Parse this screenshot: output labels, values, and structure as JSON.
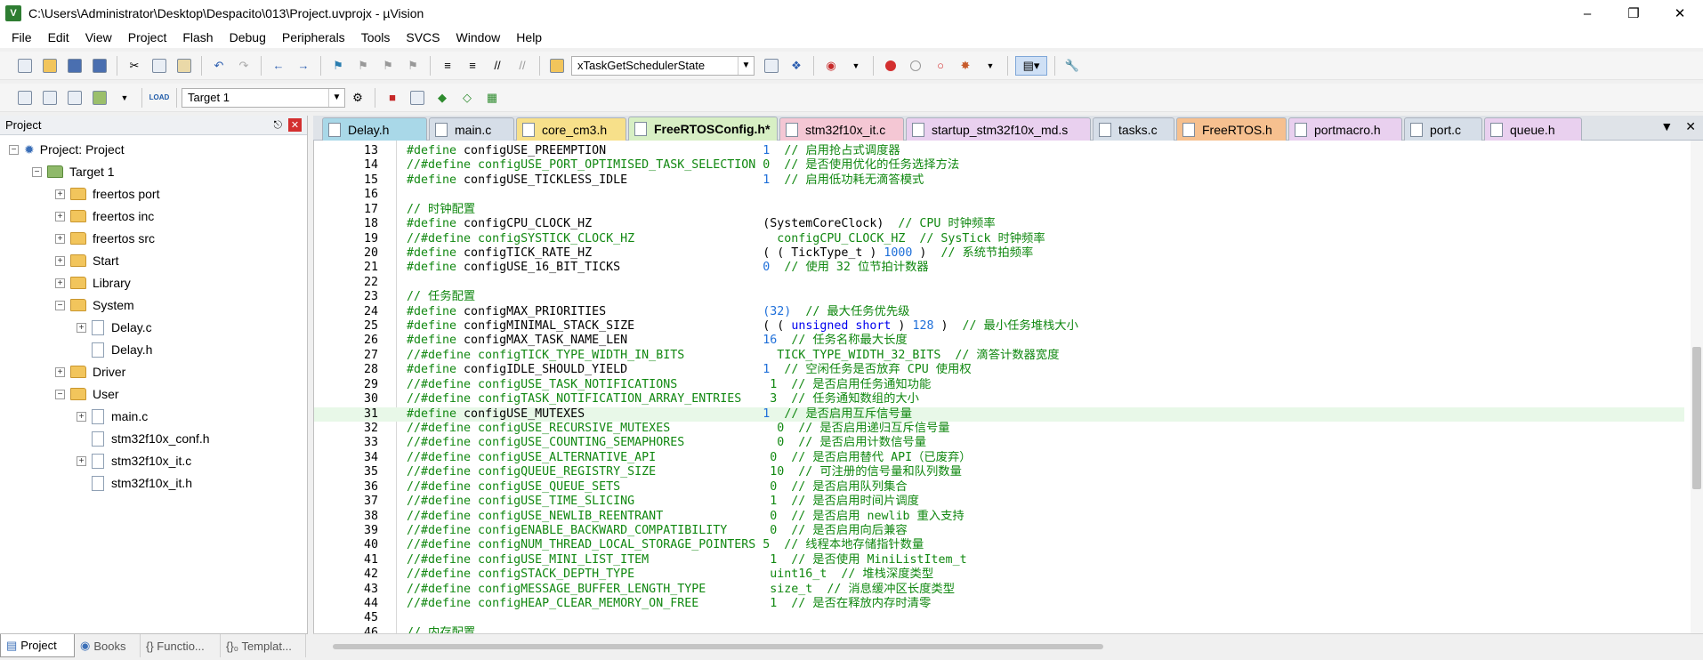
{
  "window": {
    "title": "C:\\Users\\Administrator\\Desktop\\Despacito\\013\\Project.uvprojx - µVision"
  },
  "menu": [
    "File",
    "Edit",
    "View",
    "Project",
    "Flash",
    "Debug",
    "Peripherals",
    "Tools",
    "SVCS",
    "Window",
    "Help"
  ],
  "toolbar": {
    "function_combo": "xTaskGetSchedulerState",
    "target_combo": "Target 1"
  },
  "project_panel": {
    "title": "Project",
    "tree": [
      {
        "label": "Project: Project",
        "kind": "root"
      },
      {
        "label": "Target 1",
        "kind": "target"
      },
      {
        "label": "freertos port",
        "kind": "folder"
      },
      {
        "label": "freertos inc",
        "kind": "folder"
      },
      {
        "label": "freertos src",
        "kind": "folder"
      },
      {
        "label": "Start",
        "kind": "folder"
      },
      {
        "label": "Library",
        "kind": "folder"
      },
      {
        "label": "System",
        "kind": "folder-open"
      },
      {
        "label": "Delay.c",
        "kind": "file"
      },
      {
        "label": "Delay.h",
        "kind": "file"
      },
      {
        "label": "Driver",
        "kind": "folder"
      },
      {
        "label": "User",
        "kind": "folder-open"
      },
      {
        "label": "main.c",
        "kind": "file"
      },
      {
        "label": "stm32f10x_conf.h",
        "kind": "file"
      },
      {
        "label": "stm32f10x_it.c",
        "kind": "file"
      },
      {
        "label": "stm32f10x_it.h",
        "kind": "file"
      }
    ],
    "bottom_tabs": [
      "Project",
      "Books",
      "{} Functio...",
      "{}₀ Templat..."
    ]
  },
  "editor_tabs": [
    {
      "label": "Delay.h",
      "color": "#a9d8e8"
    },
    {
      "label": "main.c",
      "color": "#d6dee8"
    },
    {
      "label": "core_cm3.h",
      "color": "#f7e08a"
    },
    {
      "label": "FreeRTOSConfig.h*",
      "color": "#d7efc4"
    },
    {
      "label": "stm32f10x_it.c",
      "color": "#f4c7d4"
    },
    {
      "label": "startup_stm32f10x_md.s",
      "color": "#e9d0ef"
    },
    {
      "label": "tasks.c",
      "color": "#d6dee8"
    },
    {
      "label": "FreeRTOS.h",
      "color": "#f6c08f"
    },
    {
      "label": "portmacro.h",
      "color": "#e9d0ef"
    },
    {
      "label": "port.c",
      "color": "#d6dee8"
    },
    {
      "label": "queue.h",
      "color": "#e9d0ef"
    }
  ],
  "code": [
    {
      "n": "13",
      "t": "#define configUSE_PREEMPTION                      1  // 启用抢占式调度器"
    },
    {
      "n": "14",
      "t": "//#define configUSE_PORT_OPTIMISED_TASK_SELECTION 0  // 是否使用优化的任务选择方法"
    },
    {
      "n": "15",
      "t": "#define configUSE_TICKLESS_IDLE                   1  // 启用低功耗无滴答模式"
    },
    {
      "n": "16",
      "t": ""
    },
    {
      "n": "17",
      "t": "// 时钟配置"
    },
    {
      "n": "18",
      "t": "#define configCPU_CLOCK_HZ                        (SystemCoreClock)  // CPU 时钟频率"
    },
    {
      "n": "19",
      "t": "//#define configSYSTICK_CLOCK_HZ                    configCPU_CLOCK_HZ  // SysTick 时钟频率"
    },
    {
      "n": "20",
      "t": "#define configTICK_RATE_HZ                        ( ( TickType_t ) 1000 )  // 系统节拍频率"
    },
    {
      "n": "21",
      "t": "#define configUSE_16_BIT_TICKS                    0  // 使用 32 位节拍计数器"
    },
    {
      "n": "22",
      "t": ""
    },
    {
      "n": "23",
      "t": "// 任务配置"
    },
    {
      "n": "24",
      "t": "#define configMAX_PRIORITIES                      (32)  // 最大任务优先级"
    },
    {
      "n": "25",
      "t": "#define configMINIMAL_STACK_SIZE                  ( ( unsigned short ) 128 )  // 最小任务堆栈大小"
    },
    {
      "n": "26",
      "t": "#define configMAX_TASK_NAME_LEN                   16  // 任务名称最大长度"
    },
    {
      "n": "27",
      "t": "//#define configTICK_TYPE_WIDTH_IN_BITS             TICK_TYPE_WIDTH_32_BITS  // 滴答计数器宽度"
    },
    {
      "n": "28",
      "t": "#define configIDLE_SHOULD_YIELD                   1  // 空闲任务是否放弃 CPU 使用权"
    },
    {
      "n": "29",
      "t": "//#define configUSE_TASK_NOTIFICATIONS             1  // 是否启用任务通知功能"
    },
    {
      "n": "30",
      "t": "//#define configTASK_NOTIFICATION_ARRAY_ENTRIES    3  // 任务通知数组的大小"
    },
    {
      "n": "31",
      "t": "#define configUSE_MUTEXES                         1  // 是否启用互斥信号量"
    },
    {
      "n": "32",
      "t": "//#define configUSE_RECURSIVE_MUTEXES               0  // 是否启用递归互斥信号量"
    },
    {
      "n": "33",
      "t": "//#define configUSE_COUNTING_SEMAPHORES             0  // 是否启用计数信号量"
    },
    {
      "n": "34",
      "t": "//#define configUSE_ALTERNATIVE_API                0  // 是否启用替代 API（已废弃）"
    },
    {
      "n": "35",
      "t": "//#define configQUEUE_REGISTRY_SIZE                10  // 可注册的信号量和队列数量"
    },
    {
      "n": "36",
      "t": "//#define configUSE_QUEUE_SETS                     0  // 是否启用队列集合"
    },
    {
      "n": "37",
      "t": "//#define configUSE_TIME_SLICING                   1  // 是否启用时间片调度"
    },
    {
      "n": "38",
      "t": "//#define configUSE_NEWLIB_REENTRANT               0  // 是否启用 newlib 重入支持"
    },
    {
      "n": "39",
      "t": "//#define configENABLE_BACKWARD_COMPATIBILITY      0  // 是否启用向后兼容"
    },
    {
      "n": "40",
      "t": "//#define configNUM_THREAD_LOCAL_STORAGE_POINTERS 5  // 线程本地存储指针数量"
    },
    {
      "n": "41",
      "t": "//#define configUSE_MINI_LIST_ITEM                 1  // 是否使用 MiniListItem_t"
    },
    {
      "n": "42",
      "t": "//#define configSTACK_DEPTH_TYPE                   uint16_t  // 堆栈深度类型"
    },
    {
      "n": "43",
      "t": "//#define configMESSAGE_BUFFER_LENGTH_TYPE         size_t  // 消息缓冲区长度类型"
    },
    {
      "n": "44",
      "t": "//#define configHEAP_CLEAR_MEMORY_ON_FREE          1  // 是否在释放内存时清零"
    },
    {
      "n": "45",
      "t": ""
    },
    {
      "n": "46",
      "t": "// 内存配置"
    }
  ],
  "current_line": "31",
  "colors": {
    "comment": "#118811",
    "keyword": "#0000ee",
    "number": "#1e6fd9",
    "current_line_bg": "#e8f8e8"
  }
}
